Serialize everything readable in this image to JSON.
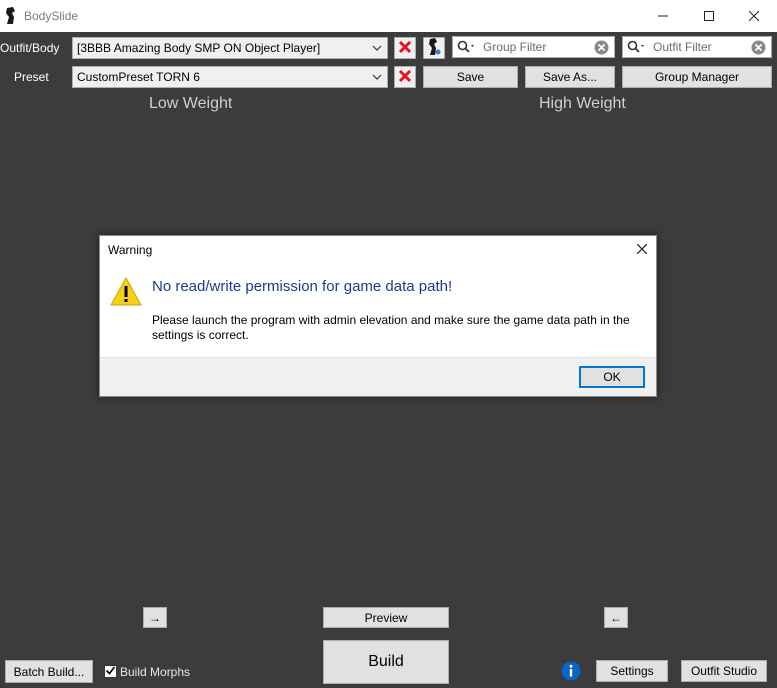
{
  "window": {
    "title": "BodySlide",
    "minimize_glyph": "—",
    "maximize_glyph": "☐",
    "close_glyph": "✕"
  },
  "outfit": {
    "label": "Outfit/Body",
    "selected": "[3BBB Amazing Body SMP ON Object Player]"
  },
  "preset": {
    "label": "Preset",
    "selected": "CustomPreset TORN 6"
  },
  "filters": {
    "group_placeholder": "Group Filter",
    "outfit_placeholder": "Outfit Filter"
  },
  "toolbar": {
    "save": "Save",
    "save_as": "Save As...",
    "group_manager": "Group Manager"
  },
  "sliders": {
    "low_weight": "Low Weight",
    "high_weight": "High Weight",
    "copy_right_arrow": "→",
    "copy_left_arrow": "←"
  },
  "bottom": {
    "preview": "Preview",
    "build": "Build",
    "batch_build": "Batch Build...",
    "build_morphs": "Build Morphs",
    "build_morphs_checked": true,
    "settings": "Settings",
    "outfit_studio": "Outfit Studio"
  },
  "dialog": {
    "title": "Warning",
    "heading": "No read/write permission for game data path!",
    "message": "Please launch the program with admin elevation and make sure the game data path in the settings is correct.",
    "ok": "OK"
  },
  "colors": {
    "background": "#3c3c3c",
    "accent": "#0078d7",
    "red_x": "#e81123",
    "heading_blue": "#1a3b8f",
    "warning_yellow": "#f7d117"
  }
}
